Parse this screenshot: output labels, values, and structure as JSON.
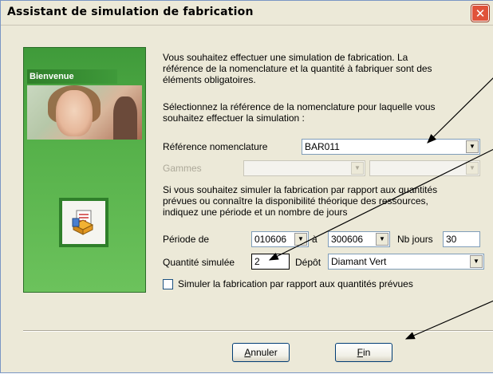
{
  "window": {
    "title": "Assistant de simulation de fabrication",
    "close_glyph": "✕"
  },
  "sidepanel": {
    "welcome": "Bienvenue"
  },
  "intro": {
    "line1": "Vous souhaitez effectuer une simulation de fabrication. La",
    "line2": "référence de la nomenclature et la quantité à fabriquer sont des",
    "line3": "éléments obligatoires.",
    "select_line1": "Sélectionnez la référence de la nomenclature pour laquelle vous",
    "select_line2": "souhaitez effectuer la simulation :"
  },
  "form": {
    "ref_label": "Référence nomenclature",
    "ref_value": "BAR011",
    "gammes_label": "Gammes",
    "gammes_value": "",
    "gammes_value2": "",
    "period_text1": "Si vous souhaitez simuler la fabrication par rapport aux quantités",
    "period_text2": "prévues ou connaître la disponibilité théorique des ressources,",
    "period_text3": "indiquez une période et un nombre de jours",
    "periode_label": "Période de",
    "periode_from": "010606",
    "periode_a": "à",
    "periode_to": "300606",
    "nbjours_label": "Nb jours",
    "nbjours_value": "30",
    "qte_label": "Quantité simulée",
    "qte_value": "2",
    "depot_label": "Dépôt",
    "depot_value": "Diamant Vert",
    "checkbox_label": "Simuler la fabrication par rapport aux quantités prévues",
    "checkbox_checked": false
  },
  "buttons": {
    "annuler_u": "A",
    "annuler_rest": "nnuler",
    "fin_u": "F",
    "fin_rest": "in"
  },
  "icons": {
    "dropdown": "▼"
  },
  "colors": {
    "dialog_bg": "#ece9d8",
    "panel_green": "#4fa844",
    "close_red": "#e0533a",
    "input_border": "#7f9db9"
  }
}
